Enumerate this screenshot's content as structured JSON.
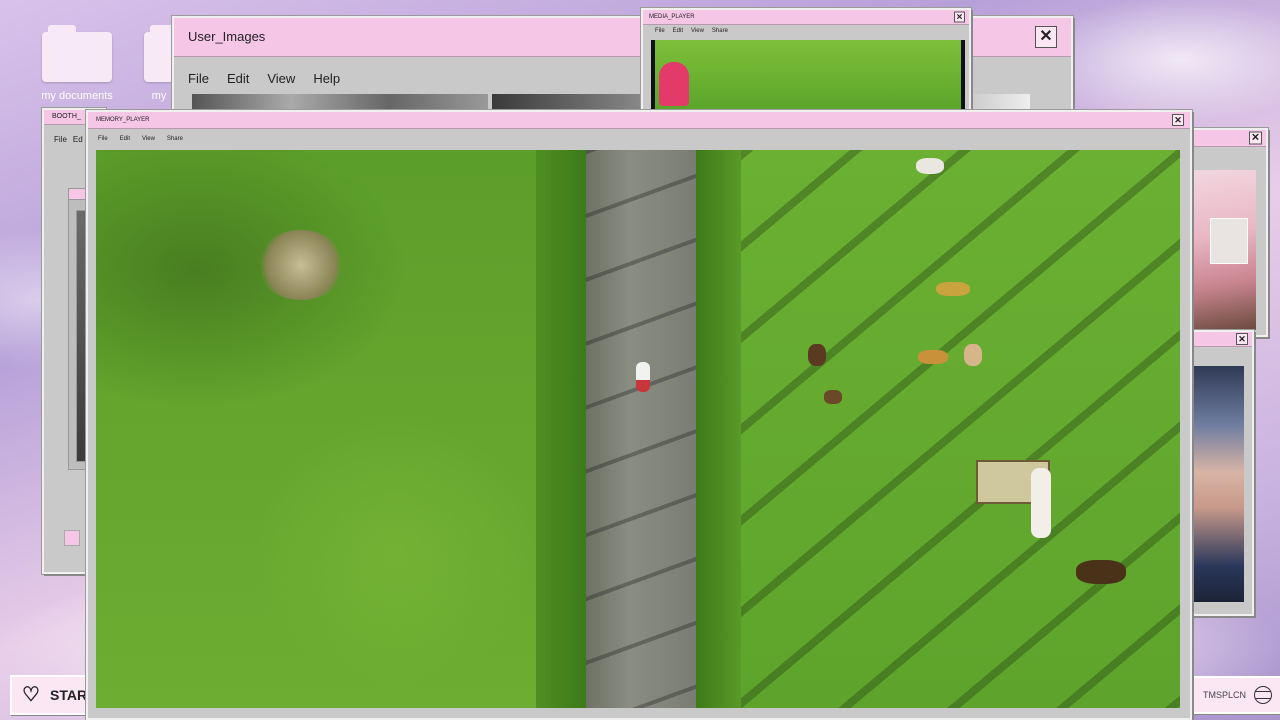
{
  "desktop": {
    "icons": [
      {
        "label": "my documents"
      },
      {
        "label": "my"
      }
    ]
  },
  "user_images_window": {
    "title": "User_Images",
    "menu": [
      "File",
      "Edit",
      "View",
      "Help"
    ],
    "close": "✕"
  },
  "media_player_small": {
    "title": "MEDIA_PLAYER",
    "menu": [
      "File",
      "Edit",
      "View",
      "Share"
    ],
    "close": "✕"
  },
  "booth_window": {
    "title": "BOOTH_",
    "menu": [
      "File",
      "Ed"
    ]
  },
  "main_player": {
    "title": "MEMORY_PLAYER",
    "menu": [
      "File",
      "Edit",
      "View",
      "Share"
    ],
    "close": "✕"
  },
  "right_windows": [
    {
      "close": "✕"
    },
    {
      "close": "✕"
    }
  ],
  "taskbar": {
    "start_label": "STAR",
    "tray_text": "TMSPLCN"
  },
  "colors": {
    "titlebar": "#f5c6e6",
    "window": "#c9c9c9",
    "grass": "#6cae31"
  }
}
